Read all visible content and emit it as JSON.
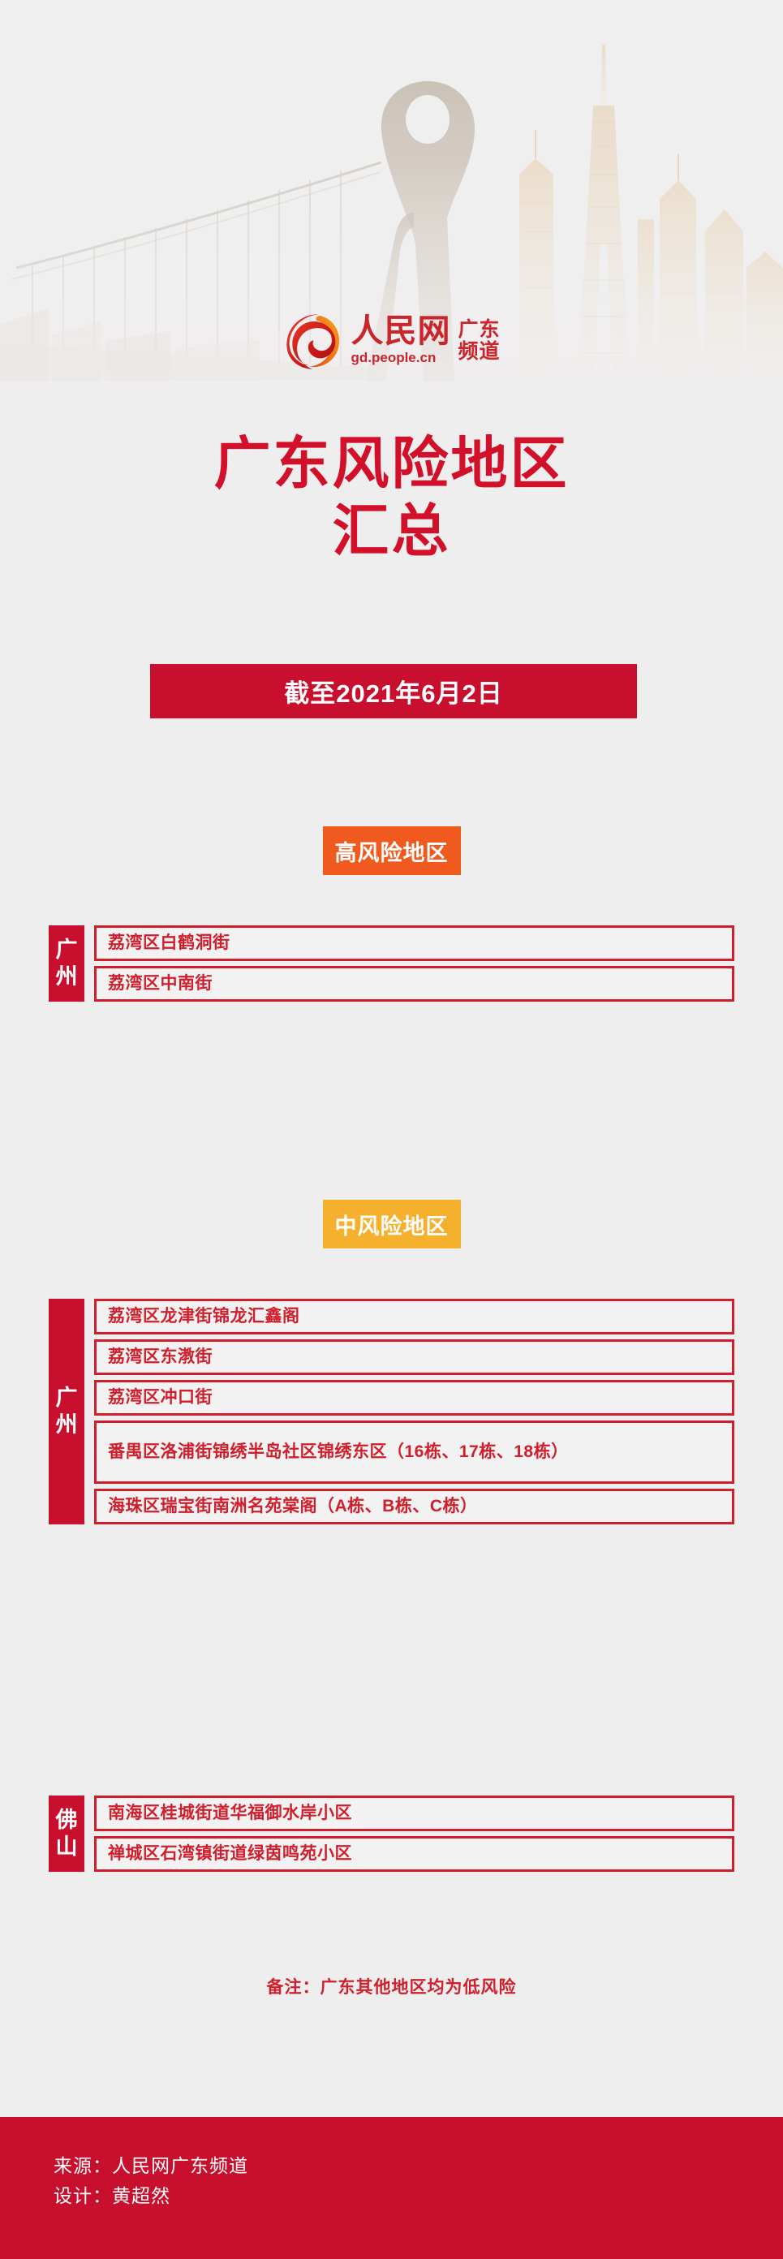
{
  "meta": {
    "background_color": "#efeeee",
    "brand_red": "#c8102e",
    "high_risk_color": "#f05a1e",
    "mid_risk_color": "#f5b02e"
  },
  "header": {
    "logo": {
      "icon_name": "people-daily-swirl-logo",
      "brand_cn": "人民网",
      "brand_url": "gd.people.cn",
      "channel_line1": "广东",
      "channel_line2": "频道"
    },
    "artwork_name": "guangzhou-skyline-watermark"
  },
  "title": {
    "line1": "广东风险地区",
    "line2": "汇总"
  },
  "date_banner": {
    "label": "截至2021年6月2日"
  },
  "sections": [
    {
      "chip_label": "高风险地区",
      "chip_color": "#f05a1e",
      "groups": [
        {
          "city": "广州",
          "city_chars": [
            "广",
            "州"
          ],
          "areas": [
            "荔湾区白鹤洞街",
            "荔湾区中南街"
          ]
        }
      ]
    },
    {
      "chip_label": "中风险地区",
      "chip_color": "#f5b02e",
      "groups": [
        {
          "city": "广州",
          "city_chars": [
            "广",
            "州"
          ],
          "areas": [
            "荔湾区龙津街锦龙汇鑫阁",
            "荔湾区东漖街",
            "荔湾区冲口街",
            "番禺区洛浦街锦绣半岛社区锦绣东区（16栋、17栋、18栋）",
            "海珠区瑞宝街南洲名苑棠阁（A栋、B栋、C栋）"
          ]
        },
        {
          "city": "佛山",
          "city_chars": [
            "佛",
            "山"
          ],
          "areas": [
            "南海区桂城街道华福御水岸小区",
            "禅城区石湾镇街道绿茵鸣苑小区"
          ]
        }
      ]
    }
  ],
  "note": {
    "text": "备注：广东其他地区均为低风险"
  },
  "footer": {
    "source": "来源：人民网广东频道",
    "designer": "设计：黄超然"
  }
}
